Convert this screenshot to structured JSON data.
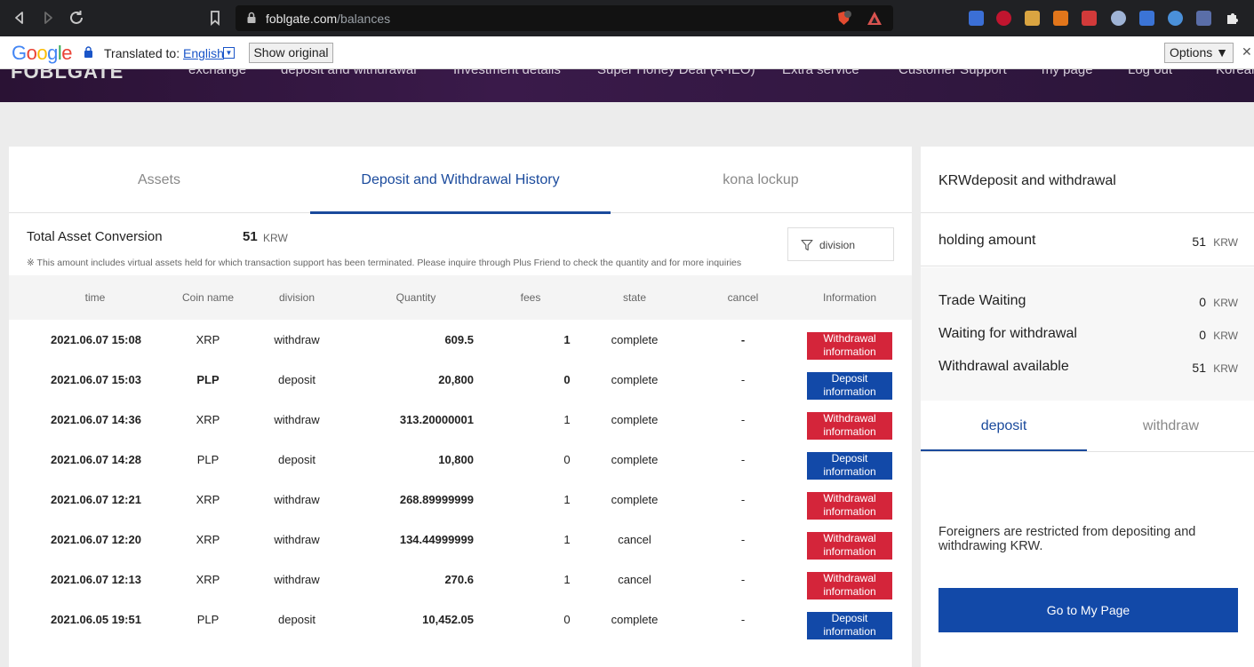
{
  "browser": {
    "url_host": "foblgate.com",
    "url_path": "/balances",
    "shield_count": "4"
  },
  "translate_bar": {
    "logo": "Google",
    "translated_to_label": "Translated to:",
    "language": "English",
    "language_arrow": "▼",
    "show_original": "Show original",
    "options": "Options ▼",
    "close": "✕"
  },
  "site": {
    "logo": "FOBLGATE",
    "menu": [
      "exchange",
      "deposit and withdrawal",
      "Investment details",
      "Super Honey Deal (A-IEO)",
      "Extra service",
      "Customer Support",
      "my page",
      "Log out",
      "Korean"
    ]
  },
  "tabs": [
    "Assets",
    "Deposit and Withdrawal History",
    "kona lockup"
  ],
  "summary": {
    "label": "Total Asset Conversion",
    "value": "51",
    "unit": "KRW",
    "note": "※ This amount includes virtual assets held for which transaction support has been terminated. Please inquire through Plus Friend to check the quantity and for more inquiries",
    "filter_label": "division"
  },
  "table": {
    "headers": [
      "time",
      "Coin name",
      "division",
      "Quantity",
      "fees",
      "state",
      "cancel",
      "Information"
    ],
    "rows": [
      {
        "time": "2021.06.07 15:08",
        "coin": "XRP",
        "division": "withdraw",
        "quantity": "609.5",
        "fees": "1",
        "state": "complete",
        "cancel": "-",
        "info": "Withdrawal information",
        "type": "withdraw",
        "bold_coin": false,
        "bold_fee": true
      },
      {
        "time": "2021.06.07 15:03",
        "coin": "PLP",
        "division": "deposit",
        "quantity": "20,800",
        "fees": "0",
        "state": "complete",
        "cancel": "-",
        "info": "Deposit information",
        "type": "deposit",
        "bold_coin": true,
        "bold_fee": true
      },
      {
        "time": "2021.06.07 14:36",
        "coin": "XRP",
        "division": "withdraw",
        "quantity": "313.20000001",
        "fees": "1",
        "state": "complete",
        "cancel": "-",
        "info": "Withdrawal information",
        "type": "withdraw",
        "bold_coin": false,
        "bold_fee": false
      },
      {
        "time": "2021.06.07 14:28",
        "coin": "PLP",
        "division": "deposit",
        "quantity": "10,800",
        "fees": "0",
        "state": "complete",
        "cancel": "-",
        "info": "Deposit information",
        "type": "deposit",
        "bold_coin": false,
        "bold_fee": false
      },
      {
        "time": "2021.06.07 12:21",
        "coin": "XRP",
        "division": "withdraw",
        "quantity": "268.89999999",
        "fees": "1",
        "state": "complete",
        "cancel": "-",
        "info": "Withdrawal information",
        "type": "withdraw",
        "bold_coin": false,
        "bold_fee": false
      },
      {
        "time": "2021.06.07 12:20",
        "coin": "XRP",
        "division": "withdraw",
        "quantity": "134.44999999",
        "fees": "1",
        "state": "cancel",
        "cancel": "-",
        "info": "Withdrawal information",
        "type": "withdraw",
        "bold_coin": false,
        "bold_fee": false
      },
      {
        "time": "2021.06.07 12:13",
        "coin": "XRP",
        "division": "withdraw",
        "quantity": "270.6",
        "fees": "1",
        "state": "cancel",
        "cancel": "-",
        "info": "Withdrawal information",
        "type": "withdraw",
        "bold_coin": false,
        "bold_fee": false
      },
      {
        "time": "2021.06.05 19:51",
        "coin": "PLP",
        "division": "deposit",
        "quantity": "10,452.05",
        "fees": "0",
        "state": "complete",
        "cancel": "-",
        "info": "Deposit information",
        "type": "deposit",
        "bold_coin": false,
        "bold_fee": false
      }
    ]
  },
  "side": {
    "title": "KRWdeposit and withdrawal",
    "holding_label": "holding amount",
    "holding_value": "51",
    "unit": "KRW",
    "trade_waiting_label": "Trade Waiting",
    "trade_waiting_value": "0",
    "waiting_withdrawal_label": "Waiting for withdrawal",
    "waiting_withdrawal_value": "0",
    "withdrawal_available_label": "Withdrawal available",
    "withdrawal_available_value": "51",
    "tab_deposit": "deposit",
    "tab_withdraw": "withdraw",
    "message": "Foreigners are restricted from depositing and withdrawing KRW.",
    "button": "Go to My Page"
  },
  "colors": {
    "accent_blue": "#1249a8",
    "withdraw_red": "#d4253a",
    "header_purple": "#2e1539"
  }
}
